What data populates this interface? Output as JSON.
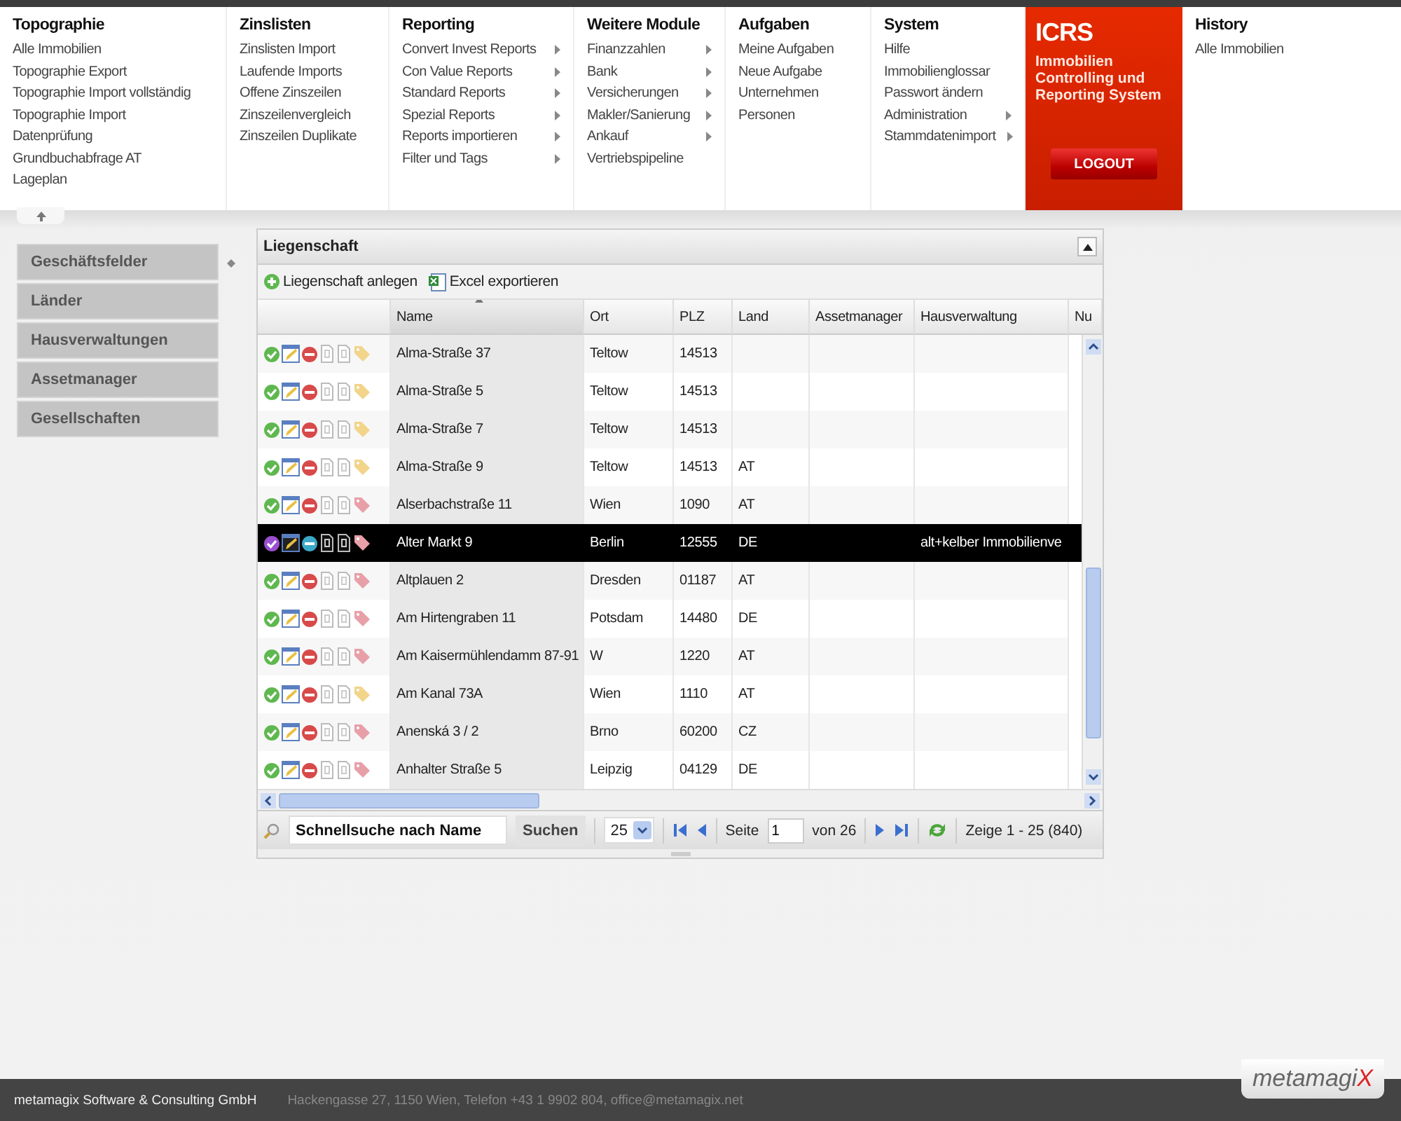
{
  "menu": [
    {
      "title": "Topographie",
      "items": [
        {
          "label": "Alle Immobilien",
          "has_submenu": false
        },
        {
          "label": "Topographie Export",
          "has_submenu": false
        },
        {
          "label": "Topographie Import vollständig",
          "has_submenu": false
        },
        {
          "label": "Topographie Import",
          "has_submenu": false
        },
        {
          "label": "Datenprüfung",
          "has_submenu": false
        },
        {
          "label": "Grundbuchabfrage AT",
          "has_submenu": false
        },
        {
          "label": "Lageplan",
          "has_submenu": false
        }
      ]
    },
    {
      "title": "Zinslisten",
      "items": [
        {
          "label": "Zinslisten Import",
          "has_submenu": false
        },
        {
          "label": "Laufende Imports",
          "has_submenu": false
        },
        {
          "label": "Offene Zinszeilen",
          "has_submenu": false
        },
        {
          "label": "Zinszeilenvergleich",
          "has_submenu": false
        },
        {
          "label": "Zinszeilen Duplikate",
          "has_submenu": false
        }
      ]
    },
    {
      "title": "Reporting",
      "items": [
        {
          "label": "Convert Invest Reports",
          "has_submenu": true
        },
        {
          "label": "Con Value Reports",
          "has_submenu": true
        },
        {
          "label": "Standard Reports",
          "has_submenu": true
        },
        {
          "label": "Spezial Reports",
          "has_submenu": true
        },
        {
          "label": "Reports importieren",
          "has_submenu": true
        },
        {
          "label": "Filter und Tags",
          "has_submenu": true
        }
      ]
    },
    {
      "title": "Weitere Module",
      "items": [
        {
          "label": "Finanzzahlen",
          "has_submenu": true
        },
        {
          "label": "Bank",
          "has_submenu": true
        },
        {
          "label": "Versicherungen",
          "has_submenu": true
        },
        {
          "label": "Makler/Sanierung",
          "has_submenu": true
        },
        {
          "label": "Ankauf",
          "has_submenu": true
        },
        {
          "label": "Vertriebspipeline",
          "has_submenu": false
        }
      ]
    },
    {
      "title": "Aufgaben",
      "items": [
        {
          "label": "Meine Aufgaben",
          "has_submenu": false
        },
        {
          "label": "Neue Aufgabe",
          "has_submenu": false
        },
        {
          "label": "Unternehmen",
          "has_submenu": false
        },
        {
          "label": "Personen",
          "has_submenu": false
        }
      ]
    },
    {
      "title": "System",
      "items": [
        {
          "label": "Hilfe",
          "has_submenu": false
        },
        {
          "label": "Immobilienglossar",
          "has_submenu": false
        },
        {
          "label": "Passwort ändern",
          "has_submenu": false
        },
        {
          "label": "Administration",
          "has_submenu": true
        },
        {
          "label": "Stammdatenimport",
          "has_submenu": true
        }
      ]
    }
  ],
  "brand": {
    "title": "ICRS",
    "subtitle": "Immobilien Controlling und Reporting System",
    "logout": "LOGOUT"
  },
  "history": {
    "title": "History",
    "items": [
      "Alle Immobilien"
    ]
  },
  "sidebar": {
    "items": [
      {
        "label": "Geschäftsfelder",
        "selected": false
      },
      {
        "label": "Länder",
        "selected": false
      },
      {
        "label": "Hausverwaltungen",
        "selected": false
      },
      {
        "label": "Assetmanager",
        "selected": false
      },
      {
        "label": "Gesellschaften",
        "selected": false
      }
    ]
  },
  "panel": {
    "title": "Liegenschaft",
    "toolbar": [
      {
        "kind": "add",
        "label": "Liegenschaft anlegen"
      },
      {
        "kind": "excel",
        "label": "Excel exportieren"
      }
    ],
    "columns": [
      "Name",
      "Ort",
      "PLZ",
      "Land",
      "Assetmanager",
      "Hausverwaltung",
      "Nu"
    ],
    "rows": [
      {
        "cells": [
          "Alma-Straße 37",
          "Teltow",
          "14513",
          "",
          "",
          ""
        ],
        "color": "#f2d48a",
        "selected": false
      },
      {
        "cells": [
          "Alma-Straße 5",
          "Teltow",
          "14513",
          "",
          "",
          ""
        ],
        "color": "#f2d48a",
        "selected": false
      },
      {
        "cells": [
          "Alma-Straße 7",
          "Teltow",
          "14513",
          "",
          "",
          ""
        ],
        "color": "#f2d48a",
        "selected": false
      },
      {
        "cells": [
          "Alma-Straße 9",
          "Teltow",
          "14513",
          "AT",
          "",
          ""
        ],
        "color": "#f2d48a",
        "selected": false
      },
      {
        "cells": [
          "Alserbachstraße 11",
          "Wien",
          "1090",
          "AT",
          "",
          ""
        ],
        "color": "#e8a0a8",
        "selected": false
      },
      {
        "cells": [
          "Alter Markt 9",
          "Berlin",
          "12555",
          "DE",
          "",
          "alt+kelber Immobilienve"
        ],
        "color": "#e8a0a8",
        "selected": true
      },
      {
        "cells": [
          "Altplauen 2",
          "Dresden",
          "01187",
          "AT",
          "",
          ""
        ],
        "color": "#e8a0a8",
        "selected": false
      },
      {
        "cells": [
          "Am Hirtengraben 11",
          "Potsdam",
          "14480",
          "DE",
          "",
          ""
        ],
        "color": "#e8a0a8",
        "selected": false
      },
      {
        "cells": [
          "Am Kaisermühlendamm 87-91",
          "W",
          "1220",
          "AT",
          "",
          ""
        ],
        "color": "#e8a0a8",
        "selected": false
      },
      {
        "cells": [
          "Am Kanal 73A",
          "Wien",
          "1110",
          "AT",
          "",
          ""
        ],
        "color": "#f2d48a",
        "selected": false
      },
      {
        "cells": [
          "Anenská 3 / 2",
          "Brno",
          "60200",
          "CZ",
          "",
          ""
        ],
        "color": "#e8a0a8",
        "selected": false
      },
      {
        "cells": [
          "Anhalter Straße 5",
          "Leipzig",
          "04129",
          "DE",
          "",
          ""
        ],
        "color": "#e8a0a8",
        "selected": false
      }
    ],
    "paging": {
      "search_value": "Schnellsuche nach Name",
      "search_button": "Suchen",
      "page_size": "25",
      "page_label": "Seite",
      "page": "1",
      "page_total": "von 26",
      "summary": "Zeige 1 - 25 (840)"
    }
  },
  "footer": {
    "company": "metamagix Software & Consulting GmbH",
    "address": "Hackengasse 27, 1150 Wien, Telefon +43 1 9902 804, office@metamagix.net",
    "logo": "metamagi",
    "logo_mark": "X"
  }
}
